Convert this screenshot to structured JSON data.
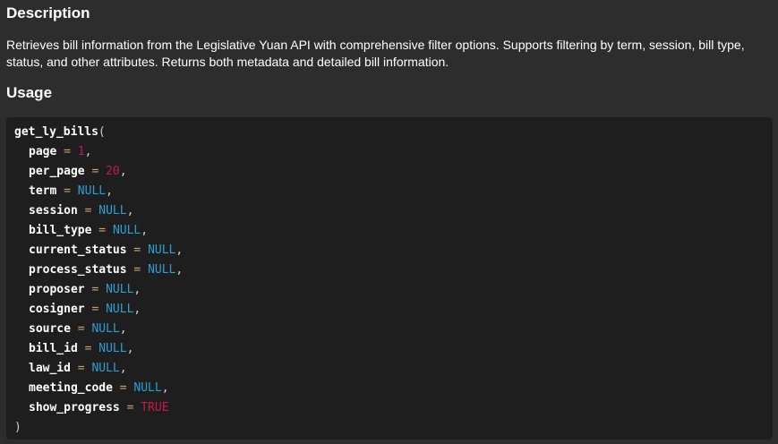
{
  "description": {
    "heading": "Description",
    "text": "Retrieves bill information from the Legislative Yuan API with comprehensive filter options. Supports filtering by term, session, bill type, status, and other attributes. Returns both metadata and detailed bill information."
  },
  "usage": {
    "heading": "Usage",
    "function_name": "get_ly_bills",
    "open_paren": "(",
    "close_paren": ")",
    "args": [
      {
        "name": "page",
        "value": "1",
        "kind": "num",
        "sep": ","
      },
      {
        "name": "per_page",
        "value": "20",
        "kind": "num",
        "sep": ","
      },
      {
        "name": "term",
        "value": "NULL",
        "kind": "null",
        "sep": ","
      },
      {
        "name": "session",
        "value": "NULL",
        "kind": "null",
        "sep": ","
      },
      {
        "name": "bill_type",
        "value": "NULL",
        "kind": "null",
        "sep": ","
      },
      {
        "name": "current_status",
        "value": "NULL",
        "kind": "null",
        "sep": ","
      },
      {
        "name": "process_status",
        "value": "NULL",
        "kind": "null",
        "sep": ","
      },
      {
        "name": "proposer",
        "value": "NULL",
        "kind": "null",
        "sep": ","
      },
      {
        "name": "cosigner",
        "value": "NULL",
        "kind": "null",
        "sep": ","
      },
      {
        "name": "source",
        "value": "NULL",
        "kind": "null",
        "sep": ","
      },
      {
        "name": "bill_id",
        "value": "NULL",
        "kind": "null",
        "sep": ","
      },
      {
        "name": "law_id",
        "value": "NULL",
        "kind": "null",
        "sep": ","
      },
      {
        "name": "meeting_code",
        "value": "NULL",
        "kind": "null",
        "sep": ","
      },
      {
        "name": "show_progress",
        "value": "TRUE",
        "kind": "true",
        "sep": ""
      }
    ],
    "equals": "="
  },
  "colors": {
    "background": "#2d2d2d",
    "code_background": "#1e1e1e",
    "number": "#c2185b",
    "null": "#2a9fd6",
    "true": "#d0144f",
    "operator": "#c9a36b"
  }
}
